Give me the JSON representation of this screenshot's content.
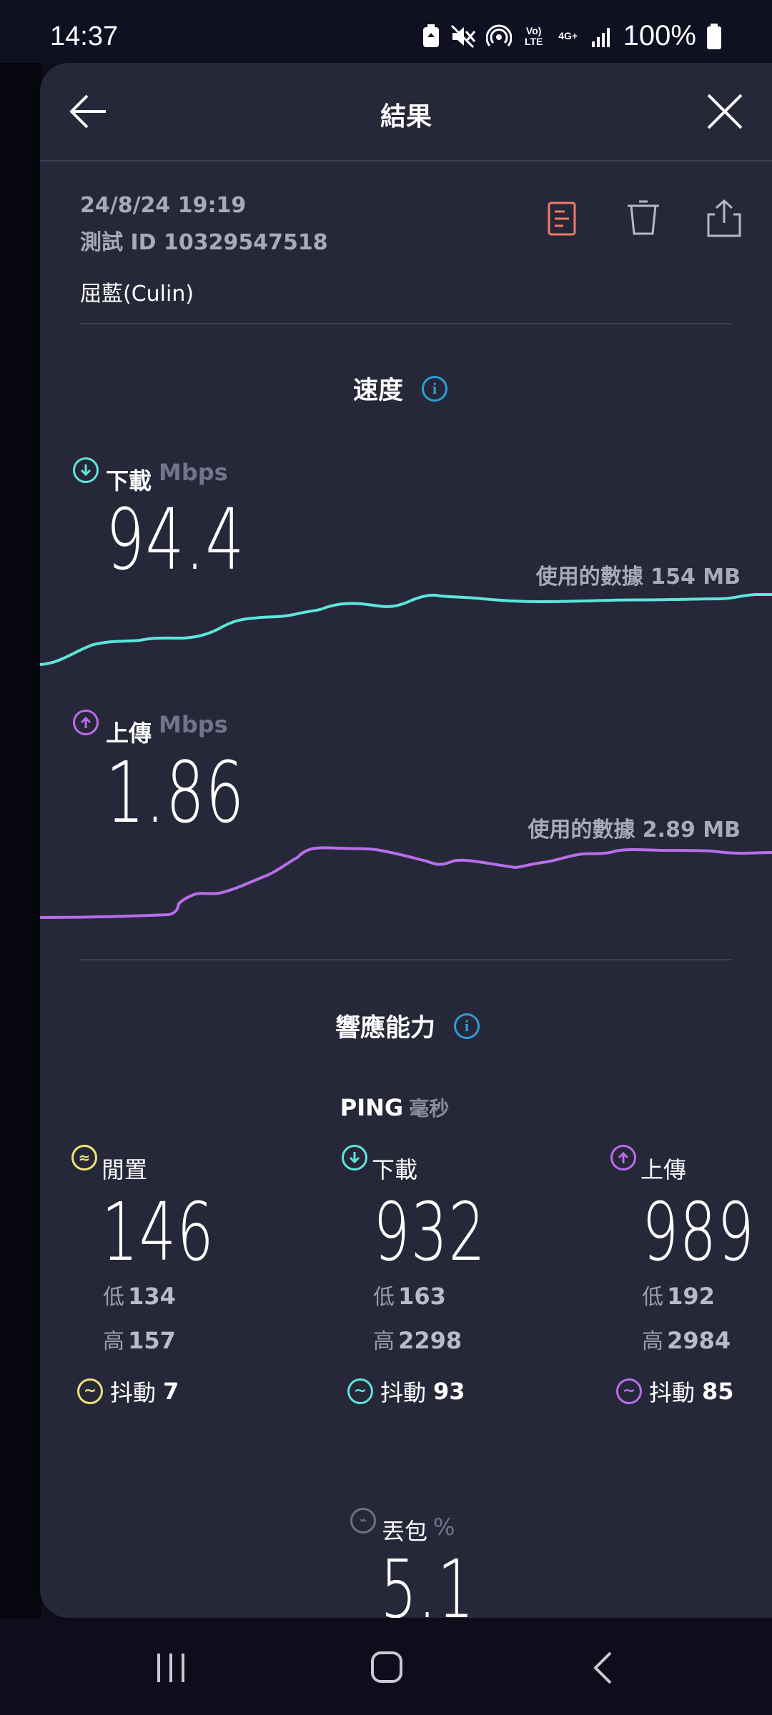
{
  "status_bar": {
    "time": "14:37",
    "volte": "Vo) LTE",
    "network": "4G+",
    "battery": "100%",
    "icons": [
      "battery-saver-icon",
      "mute-icon",
      "hotspot-icon",
      "volte-icon",
      "4g-icon",
      "signal-icon",
      "battery-icon"
    ]
  },
  "header": {
    "title": "結果",
    "back_icon": "back-arrow-icon",
    "close_icon": "close-icon"
  },
  "test_info": {
    "datetime": "24/8/24 19:19",
    "test_id": "測試 ID 10329547518",
    "provider": "屈藍(Culin)",
    "actions": [
      "report-icon",
      "trash-icon",
      "share-icon"
    ]
  },
  "speed": {
    "title": "速度",
    "download": {
      "label": "下載",
      "unit": "Mbps",
      "value": "94.4",
      "data_used": "使用的數據 154 MB",
      "color": "#5de5dc"
    },
    "upload": {
      "label": "上傳",
      "unit": "Mbps",
      "value": "1.86",
      "data_used": "使用的數據 2.89 MB",
      "color": "#b86ee9"
    }
  },
  "responsiveness": {
    "title": "響應能力",
    "ping_label": "PING",
    "ping_unit": "毫秒",
    "columns": [
      {
        "label": "閒置",
        "value": "146",
        "low_label": "低",
        "low": "134",
        "high_label": "高",
        "high": "157",
        "jitter_label": "抖動",
        "jitter": "7",
        "color": "#f1e17a"
      },
      {
        "label": "下載",
        "value": "932",
        "low_label": "低",
        "low": "163",
        "high_label": "高",
        "high": "2298",
        "jitter_label": "抖動",
        "jitter": "93",
        "color": "#5de5dc"
      },
      {
        "label": "上傳",
        "value": "989",
        "low_label": "低",
        "low": "192",
        "high_label": "高",
        "high": "2984",
        "jitter_label": "抖動",
        "jitter": "85",
        "color": "#b86ee9"
      }
    ]
  },
  "packet_loss": {
    "label": "丟包",
    "unit": "%",
    "value": "5.1"
  },
  "nav": [
    "recents-icon",
    "home-icon",
    "back-icon"
  ]
}
